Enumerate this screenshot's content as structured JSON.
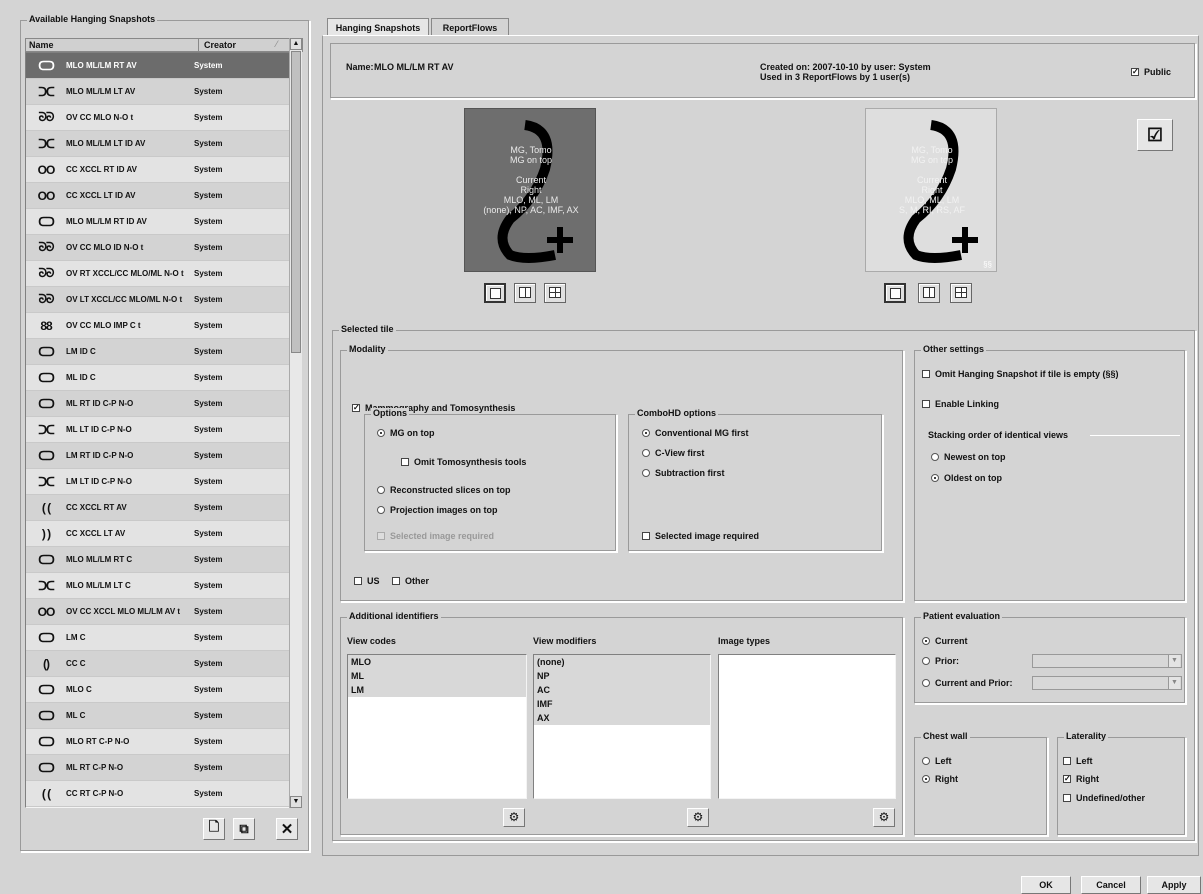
{
  "left_panel": {
    "title": "Available Hanging Snapshots",
    "col_name": "Name",
    "col_creator": "Creator",
    "rows": [
      {
        "icon": "ᑕᑐ",
        "name": "MLO ML/LM RT AV",
        "creator": "System"
      },
      {
        "icon": "ᑐᑕ",
        "name": "MLO ML/LM LT AV",
        "creator": "System"
      },
      {
        "icon": "ᘐᘐ",
        "name": "OV CC MLO N-O t",
        "creator": "System"
      },
      {
        "icon": "ᑐᑕ",
        "name": "MLO ML/LM LT ID AV",
        "creator": "System"
      },
      {
        "icon": "OO",
        "name": "CC XCCL RT ID AV",
        "creator": "System"
      },
      {
        "icon": "OO",
        "name": "CC XCCL LT ID AV",
        "creator": "System"
      },
      {
        "icon": "ᑕᑐ",
        "name": "MLO ML/LM RT ID AV",
        "creator": "System"
      },
      {
        "icon": "ᘐᘐ",
        "name": "OV CC MLO ID N-O t",
        "creator": "System"
      },
      {
        "icon": "ᘐᘐ",
        "name": "OV RT XCCL/CC MLO/ML N-O t",
        "creator": "System"
      },
      {
        "icon": "ᘐᘐ",
        "name": "OV LT XCCL/CC MLO/ML N-O t",
        "creator": "System"
      },
      {
        "icon": "88",
        "name": "OV CC MLO IMP C t",
        "creator": "System"
      },
      {
        "icon": "ᑕᑐ",
        "name": "LM ID C",
        "creator": "System"
      },
      {
        "icon": "ᑕᑐ",
        "name": "ML ID C",
        "creator": "System"
      },
      {
        "icon": "ᑕᑐ",
        "name": "ML RT ID C-P N-O",
        "creator": "System"
      },
      {
        "icon": "ᑐᑕ",
        "name": "ML LT ID C-P N-O",
        "creator": "System"
      },
      {
        "icon": "ᑕᑐ",
        "name": "LM RT ID C-P N-O",
        "creator": "System"
      },
      {
        "icon": "ᑐᑕ",
        "name": "LM LT ID C-P N-O",
        "creator": "System"
      },
      {
        "icon": "( (",
        "name": "CC XCCL RT AV",
        "creator": "System"
      },
      {
        "icon": ") )",
        "name": "CC XCCL LT AV",
        "creator": "System"
      },
      {
        "icon": "ᑕᑐ",
        "name": "MLO ML/LM RT C",
        "creator": "System"
      },
      {
        "icon": "ᑐᑕ",
        "name": "MLO ML/LM LT C",
        "creator": "System"
      },
      {
        "icon": "OO",
        "name": "OV CC XCCL MLO ML/LM AV t",
        "creator": "System"
      },
      {
        "icon": "ᑕᑐ",
        "name": "LM C",
        "creator": "System"
      },
      {
        "icon": "()",
        "name": "CC C",
        "creator": "System"
      },
      {
        "icon": "ᑕᑐ",
        "name": "MLO C",
        "creator": "System"
      },
      {
        "icon": "ᑕᑐ",
        "name": "ML C",
        "creator": "System"
      },
      {
        "icon": "ᑕᑐ",
        "name": "MLO RT C-P N-O",
        "creator": "System"
      },
      {
        "icon": "ᑕᑐ",
        "name": "ML RT C-P N-O",
        "creator": "System"
      },
      {
        "icon": "( (",
        "name": "CC RT C-P N-O",
        "creator": "System"
      }
    ],
    "selected_index": 0
  },
  "tabs": [
    {
      "label": "Hanging Snapshots",
      "active": true
    },
    {
      "label": "ReportFlows",
      "active": false
    }
  ],
  "header": {
    "name_label": "Name:",
    "name_value": "MLO ML/LM RT AV",
    "created_line": "Created on: 2007-10-10 by user: System",
    "used_line": "Used in 3 ReportFlows by 1 user(s)",
    "public_label": "Public",
    "public_checked": true
  },
  "tiles": [
    {
      "lines": [
        "MG, Tomo",
        "MG on top",
        "",
        "Current",
        "Right",
        "MLO, ML, LM",
        "(none), NP, AC, IMF, AX"
      ],
      "selected": true
    },
    {
      "lines": [
        "MG, Tomo",
        "MG on top",
        "",
        "Current",
        "Right",
        "MLO, ML, LM",
        "S, M, RI, RS, AF"
      ],
      "selected": false,
      "footnote": "§§"
    }
  ],
  "selected_tile": {
    "title": "Selected tile",
    "modality": {
      "title": "Modality",
      "mammo_label": "Mammography and Tomosynthesis",
      "options_title": "Options",
      "mg_on_top": "MG on top",
      "omit_tomo": "Omit Tomosynthesis tools",
      "recon_slices": "Reconstructed slices on top",
      "projection": "Projection images on top",
      "selected_image_required": "Selected image required",
      "combo_title": "ComboHD options",
      "conventional": "Conventional MG first",
      "cview": "C-View first",
      "subtraction": "Subtraction first",
      "combo_selected_required": "Selected image required",
      "us": "US",
      "other": "Other"
    },
    "other_settings": {
      "title": "Other settings",
      "omit": "Omit Hanging Snapshot if tile is empty (§§)",
      "linking": "Enable Linking",
      "stacking_title": "Stacking order of identical views",
      "newest": "Newest on top",
      "oldest": "Oldest on top"
    },
    "additional": {
      "title": "Additional identifiers",
      "view_codes_title": "View codes",
      "view_codes": [
        "MLO",
        "ML",
        "LM"
      ],
      "view_modifiers_title": "View modifiers",
      "view_modifiers": [
        "(none)",
        "NP",
        "AC",
        "IMF",
        "AX"
      ],
      "image_types_title": "Image types",
      "image_types": []
    },
    "patient_eval": {
      "title": "Patient evaluation",
      "current": "Current",
      "prior": "Prior:",
      "current_and_prior": "Current and Prior:"
    },
    "chest_wall": {
      "title": "Chest wall",
      "left": "Left",
      "right": "Right"
    },
    "laterality": {
      "title": "Laterality",
      "left": "Left",
      "right": "Right",
      "undefined": "Undefined/other"
    }
  },
  "footer": {
    "ok": "OK",
    "cancel": "Cancel",
    "apply": "Apply"
  }
}
